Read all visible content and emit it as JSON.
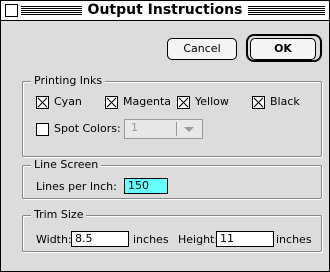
{
  "window": {
    "title": "Output Instructions"
  },
  "buttons": {
    "cancel": "Cancel",
    "ok": "OK"
  },
  "printing_inks": {
    "title": "Printing Inks",
    "inks": [
      {
        "label": "Cyan",
        "checked": true
      },
      {
        "label": "Magenta",
        "checked": true
      },
      {
        "label": "Yellow",
        "checked": true
      },
      {
        "label": "Black",
        "checked": true
      }
    ],
    "spot_colors": {
      "label": "Spot Colors:",
      "checked": false,
      "value": "1",
      "enabled": false
    }
  },
  "line_screen": {
    "title": "Line Screen",
    "label": "Lines per Inch:",
    "value": "150",
    "highlight_color": "#66ffff"
  },
  "trim_size": {
    "title": "Trim Size",
    "width_label": "Width:",
    "width_value": "8.5",
    "width_unit": "inches",
    "height_label": "Height:",
    "height_value": "11",
    "height_unit": "inches"
  }
}
